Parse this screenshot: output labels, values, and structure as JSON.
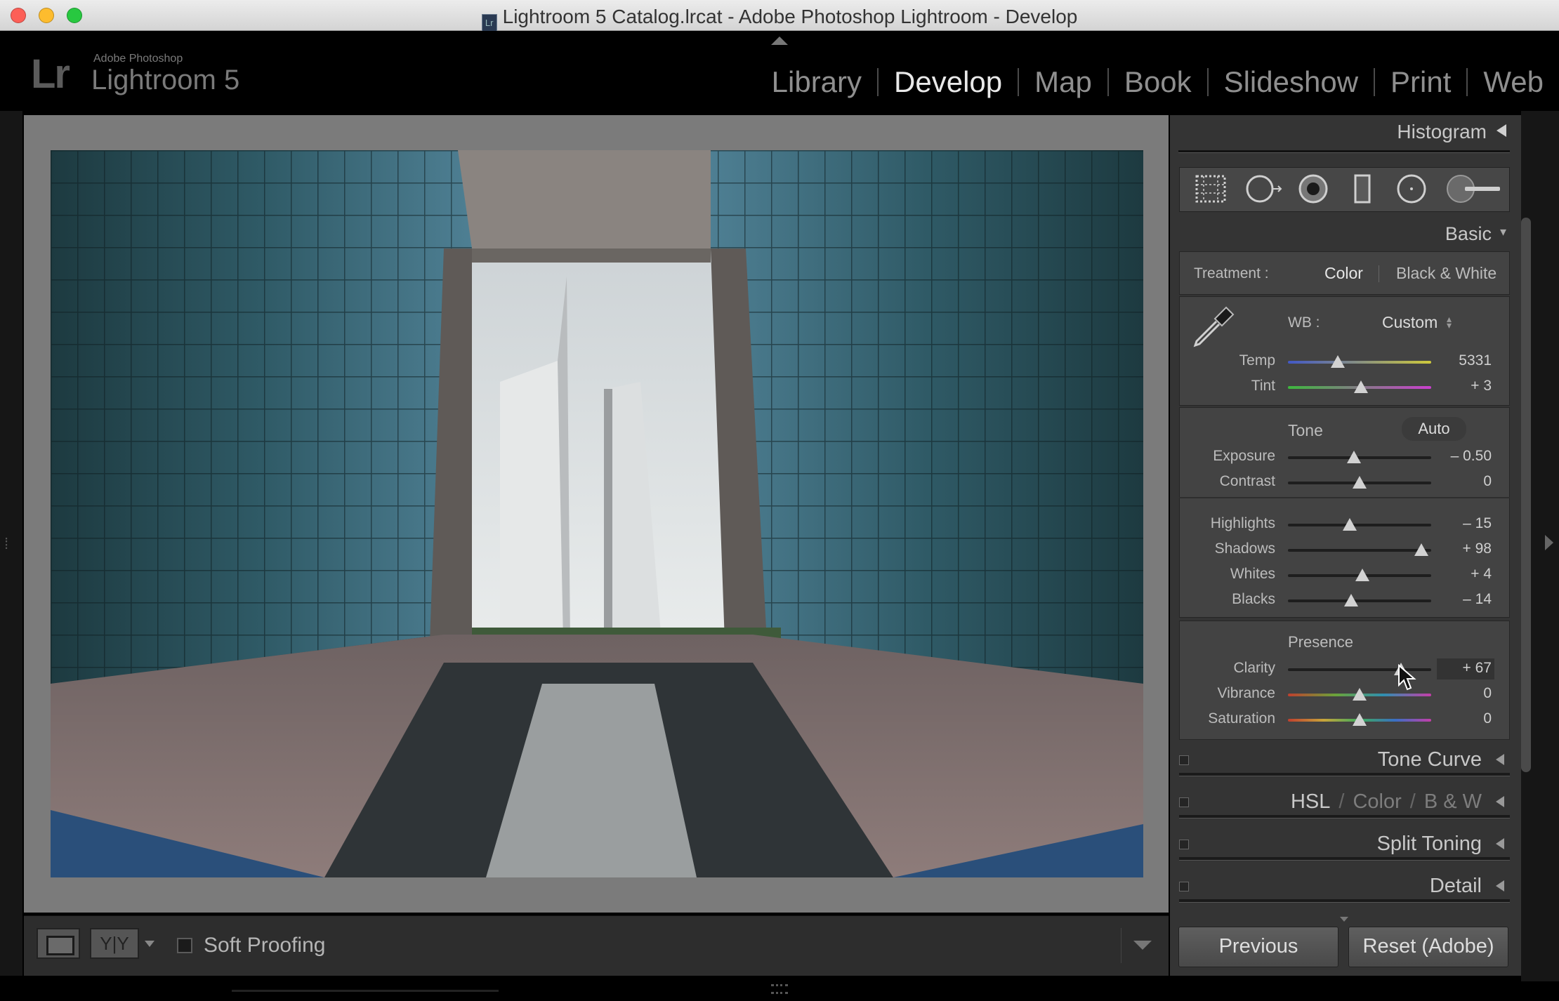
{
  "window": {
    "title": "Lightroom 5 Catalog.lrcat - Adobe Photoshop Lightroom - Develop",
    "doc_icon": "Lr"
  },
  "brand": {
    "logo": "Lr",
    "company": "Adobe Photoshop",
    "product": "Lightroom 5"
  },
  "modules": [
    {
      "label": "Library",
      "active": false
    },
    {
      "label": "Develop",
      "active": true
    },
    {
      "label": "Map",
      "active": false
    },
    {
      "label": "Book",
      "active": false
    },
    {
      "label": "Slideshow",
      "active": false
    },
    {
      "label": "Print",
      "active": false
    },
    {
      "label": "Web",
      "active": false
    }
  ],
  "toolbar": {
    "soft_proofing": "Soft Proofing",
    "compare_label": "Y|Y"
  },
  "panel": {
    "histogram": "Histogram",
    "basic": "Basic",
    "treatment": {
      "label": "Treatment :",
      "color": "Color",
      "bw": "Black & White"
    },
    "wb": {
      "label": "WB :",
      "value": "Custom"
    },
    "temp": {
      "label": "Temp",
      "value": "5331",
      "position": 0.35
    },
    "tint": {
      "label": "Tint",
      "value": "+ 3",
      "position": 0.51
    },
    "tone": {
      "label": "Tone",
      "auto": "Auto"
    },
    "exposure": {
      "label": "Exposure",
      "value": "– 0.50",
      "position": 0.46
    },
    "contrast": {
      "label": "Contrast",
      "value": "0",
      "position": 0.5
    },
    "highlights": {
      "label": "Highlights",
      "value": "– 15",
      "position": 0.43
    },
    "shadows": {
      "label": "Shadows",
      "value": "+ 98",
      "position": 0.93
    },
    "whites": {
      "label": "Whites",
      "value": "+ 4",
      "position": 0.52
    },
    "blacks": {
      "label": "Blacks",
      "value": "– 14",
      "position": 0.44
    },
    "presence": {
      "label": "Presence"
    },
    "clarity": {
      "label": "Clarity",
      "value": "+ 67",
      "position": 0.79
    },
    "vibrance": {
      "label": "Vibrance",
      "value": "0",
      "position": 0.5
    },
    "saturation": {
      "label": "Saturation",
      "value": "0",
      "position": 0.5
    },
    "tone_curve": "Tone Curve",
    "hsl": {
      "hsl": "HSL",
      "sep": "/",
      "color": "Color",
      "bw": "B & W"
    },
    "split_toning": "Split Toning",
    "detail": "Detail",
    "previous": "Previous",
    "reset": "Reset (Adobe)"
  },
  "tools": [
    "crop-overlay-icon",
    "spot-removal-icon",
    "red-eye-icon",
    "graduated-filter-icon",
    "radial-filter-icon",
    "adjustment-brush-icon"
  ]
}
